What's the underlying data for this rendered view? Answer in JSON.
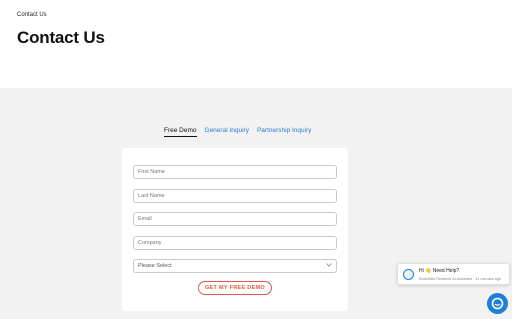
{
  "header": {
    "breadcrumb": "Contact Us",
    "title": "Contact Us"
  },
  "tabs": [
    {
      "label": "Free Demo",
      "active": true
    },
    {
      "label": "General Inquiry",
      "active": false
    },
    {
      "label": "Partnership Inquiry",
      "active": false
    }
  ],
  "form": {
    "first_name_placeholder": "First Name",
    "last_name_placeholder": "Last Name",
    "email_placeholder": "Email",
    "company_placeholder": "Company",
    "select_value": "Please Select",
    "submit_label": "GET MY FREE DEMO"
  },
  "chat": {
    "title": "Hi 👋 Need Help?",
    "subtitle": "Bucketlist Rewards AI Assistant · 11 minutes ago"
  },
  "colors": {
    "accent_blue": "#1e7fd6",
    "link_blue": "#2a7bd0",
    "submit_red": "#e05a4a",
    "section_bg": "#f2f2f2"
  },
  "icons": {
    "select": "chevron-down-icon",
    "chat_avatar": "chat-avatar-icon",
    "chat_launcher": "chat-launcher-icon"
  }
}
